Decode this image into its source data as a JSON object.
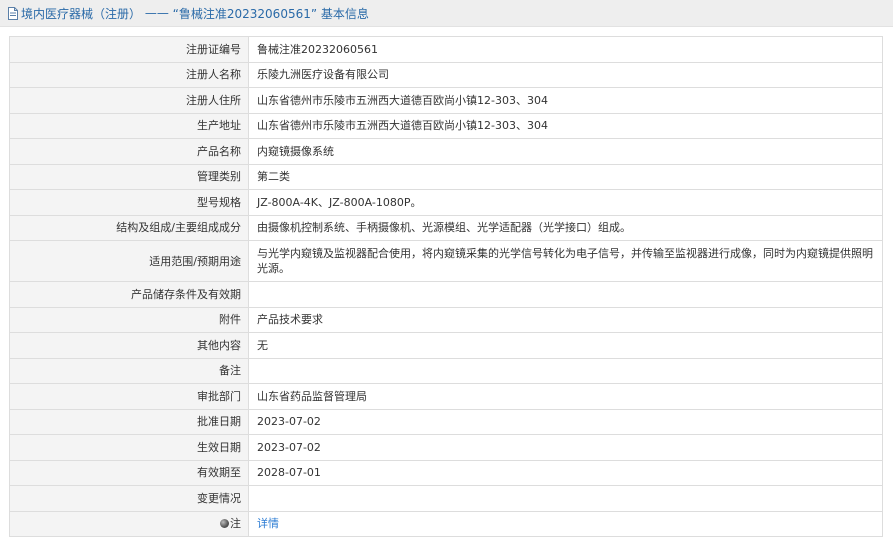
{
  "header": {
    "icon": "document-icon",
    "title_prefix": "境内医疗器械（注册）",
    "separator": " —— ",
    "title_record": "“鲁械注准20232060561”",
    "title_suffix": " 基本信息"
  },
  "rows": [
    {
      "label": "注册证编号",
      "value": "鲁械注准20232060561"
    },
    {
      "label": "注册人名称",
      "value": "乐陵九洲医疗设备有限公司"
    },
    {
      "label": "注册人住所",
      "value": "山东省德州市乐陵市五洲西大道德百欧尚小镇12-303、304"
    },
    {
      "label": "生产地址",
      "value": "山东省德州市乐陵市五洲西大道德百欧尚小镇12-303、304"
    },
    {
      "label": "产品名称",
      "value": "内窥镜摄像系统"
    },
    {
      "label": "管理类别",
      "value": "第二类"
    },
    {
      "label": "型号规格",
      "value": "JZ-800A-4K、JZ-800A-1080P。"
    },
    {
      "label": "结构及组成/主要组成成分",
      "value": "由摄像机控制系统、手柄摄像机、光源模组、光学适配器（光学接口）组成。"
    },
    {
      "label": "适用范围/预期用途",
      "value": "与光学内窥镜及监视器配合使用，将内窥镜采集的光学信号转化为电子信号，并传输至监视器进行成像，同时为内窥镜提供照明光源。"
    },
    {
      "label": "产品储存条件及有效期",
      "value": ""
    },
    {
      "label": "附件",
      "value": "产品技术要求"
    },
    {
      "label": "其他内容",
      "value": "无"
    },
    {
      "label": "备注",
      "value": ""
    },
    {
      "label": "审批部门",
      "value": "山东省药品监督管理局"
    },
    {
      "label": "批准日期",
      "value": "2023-07-02"
    },
    {
      "label": "生效日期",
      "value": "2023-07-02"
    },
    {
      "label": "有效期至",
      "value": "2028-07-01"
    },
    {
      "label": "变更情况",
      "value": ""
    }
  ],
  "note": {
    "icon": "note-bullet-icon",
    "label": "注",
    "link_text": "详情",
    "link_color": "#2a7bd3"
  },
  "colors": {
    "header_text": "#2a6aa8",
    "header_bg": "#eeeeee",
    "label_bg": "#f4f4f4",
    "border": "#dddddd"
  }
}
